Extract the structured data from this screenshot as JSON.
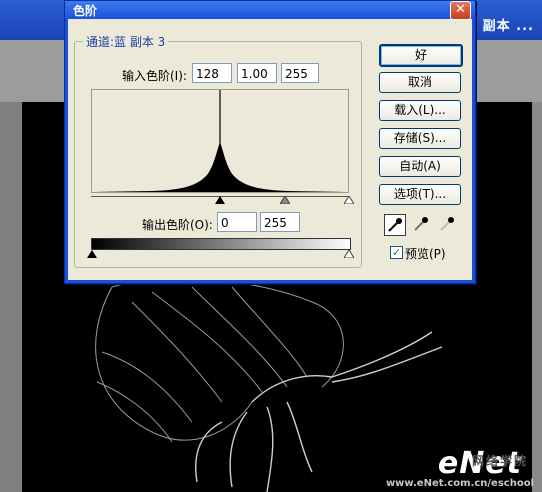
{
  "background_app": {
    "title_fragment": "3 副本 ...",
    "watermark_logo": "eNet",
    "watermark_cn": "网络学院",
    "watermark_url": "www.eNet.com.cn/eschool"
  },
  "dialog": {
    "title": "色阶",
    "close_glyph": "✕",
    "channel_label": "通道:蓝 副本 3",
    "input_levels_label": "输入色阶(I):",
    "input_black": "128",
    "input_gamma": "1.00",
    "input_white": "255",
    "output_levels_label": "输出色阶(O):",
    "output_black": "0",
    "output_white": "255",
    "buttons": {
      "ok": "好",
      "cancel": "取消",
      "load": "载入(L)...",
      "save": "存储(S)...",
      "auto": "自动(A)",
      "options": "选项(T)..."
    },
    "tools": [
      "black-eyedropper-icon",
      "gray-eyedropper-icon",
      "white-eyedropper-icon"
    ],
    "preview_label": "预览(P)",
    "preview_checked": true,
    "check_glyph": "✓"
  },
  "colors": {
    "title_bar": "#1c50d8",
    "dialog_bg": "#ece9d8",
    "group_label": "#1f3fa8",
    "close_button": "#c43c1e"
  }
}
